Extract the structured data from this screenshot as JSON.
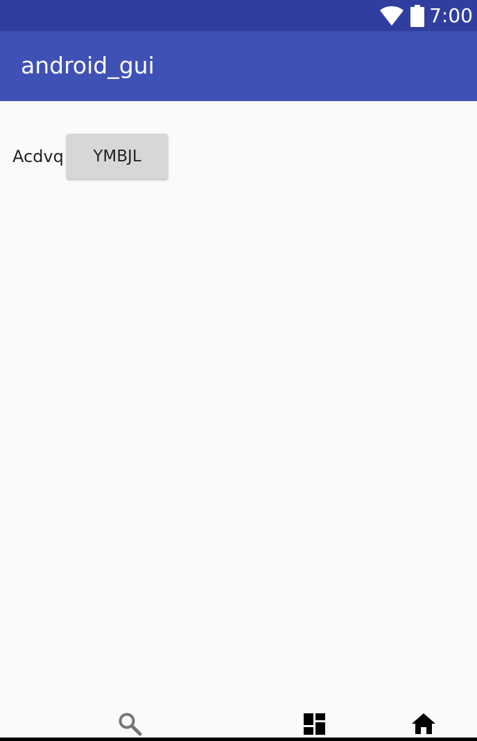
{
  "status_bar": {
    "time": "7:00",
    "wifi_icon": "wifi-icon",
    "battery_icon": "battery-icon"
  },
  "app_bar": {
    "title": "android_gui"
  },
  "content": {
    "label": "Acdvq",
    "button_label": "YMBJL"
  },
  "bottom_nav": {
    "items": [
      {
        "icon": "search-icon"
      },
      {
        "icon": "dashboard-icon"
      },
      {
        "icon": "home-icon"
      }
    ]
  },
  "colors": {
    "status_bar": "#303f9f",
    "app_bar": "#3f51b5",
    "background": "#fafafa",
    "button": "#d6d7d7"
  }
}
